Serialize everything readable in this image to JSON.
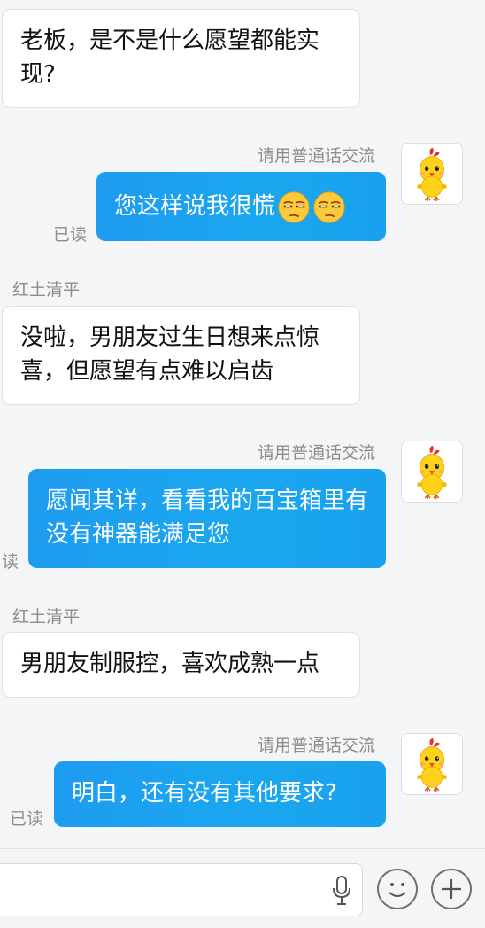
{
  "messages": [
    {
      "side": "in",
      "text": "老板，是不是什么愿望都能实现?"
    },
    {
      "side": "out",
      "nick": "请用普通话交流",
      "text": "您这样说我很慌",
      "status": "已读"
    },
    {
      "side": "in",
      "sender": "红土清平",
      "text": "没啦，男朋友过生日想来点惊喜，但愿望有点难以启齿"
    },
    {
      "side": "out",
      "nick": "请用普通话交流",
      "text": "愿闻其详，看看我的百宝箱里有没有神器能满足您",
      "status": "读"
    },
    {
      "side": "in",
      "sender": "红土清平",
      "text": "男朋友制服控，喜欢成熟一点"
    },
    {
      "side": "out",
      "nick": "请用普通话交流",
      "text": "明白，还有没有其他要求?",
      "status": "已读"
    }
  ],
  "icons": {
    "avatar": "yellow-chick-avatar-icon",
    "emoji": "unamused-face-icon",
    "mic": "microphone-icon",
    "emoji_button": "smiley-icon",
    "plus": "plus-icon"
  },
  "colors": {
    "outgoing_bubble": "#1ea0f0",
    "incoming_bubble": "#ffffff",
    "background": "#f4f5f7"
  }
}
